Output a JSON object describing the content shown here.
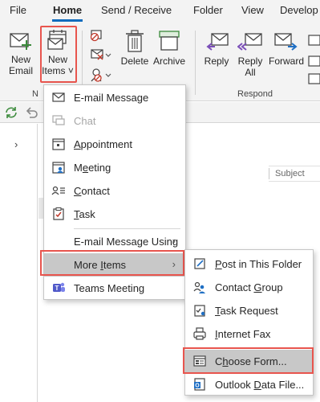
{
  "tabs": [
    {
      "label": "File"
    },
    {
      "label": "Home"
    },
    {
      "label": "Send / Receive"
    },
    {
      "label": "Folder"
    },
    {
      "label": "View"
    },
    {
      "label": "Develop"
    }
  ],
  "ribbon": {
    "new_email": "New\nEmail",
    "new_email_l1": "New",
    "new_email_l2": "Email",
    "new_items_l1": "New",
    "new_items_l2": "Items ˅",
    "delete": "Delete",
    "archive": "Archive",
    "reply": "Reply",
    "reply_all_l1": "Reply",
    "reply_all_l2": "All",
    "forward": "Forward",
    "group_new_partial": "N",
    "group_respond": "Respond"
  },
  "list": {
    "subject_header": "Subject"
  },
  "new_items_menu": [
    {
      "label": "E-mail Message",
      "icon": "email-icon",
      "disabled": false,
      "submenu": false
    },
    {
      "label": "Chat",
      "icon": "chat-icon",
      "disabled": true,
      "submenu": false
    },
    {
      "label": "Appointment",
      "icon": "calendar-icon",
      "disabled": false,
      "submenu": false
    },
    {
      "label": "Meeting",
      "icon": "meeting-icon",
      "disabled": false,
      "submenu": false
    },
    {
      "label": "Contact",
      "icon": "contact-icon",
      "disabled": false,
      "submenu": false
    },
    {
      "label": "Task",
      "icon": "task-icon",
      "disabled": false,
      "submenu": false
    },
    {
      "label": "E-mail Message Using",
      "icon": "",
      "disabled": false,
      "submenu": true
    },
    {
      "label": "More Items",
      "icon": "",
      "disabled": false,
      "submenu": true,
      "highlighted": true
    },
    {
      "label": "Teams Meeting",
      "icon": "teams-icon",
      "disabled": false,
      "submenu": false
    }
  ],
  "more_items_menu": [
    {
      "label": "Post in This Folder",
      "icon": "post-icon"
    },
    {
      "label": "Contact Group",
      "icon": "contact-group-icon"
    },
    {
      "label": "Task Request",
      "icon": "task-request-icon"
    },
    {
      "label": "Internet Fax",
      "icon": "fax-icon"
    },
    {
      "label": "Choose Form...",
      "icon": "form-icon",
      "highlighted": true
    },
    {
      "label": "Outlook Data File...",
      "icon": "data-file-icon"
    }
  ],
  "colors": {
    "accent": "#0f6cbd",
    "highlight_box": "#e8554e",
    "hover_bg": "#c8c8c8"
  }
}
